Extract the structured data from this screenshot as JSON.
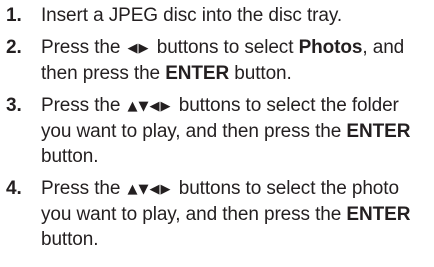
{
  "steps": [
    {
      "num": "1.",
      "p1": "Insert a JPEG disc into the disc tray."
    },
    {
      "num": "2.",
      "p1": "Press the ",
      "arrows": "◀▶",
      "p2": " buttons to select ",
      "bold1": "Photos",
      "p3": ", and then press the ",
      "bold2": "ENTER",
      "p4": " button."
    },
    {
      "num": "3.",
      "p1": "Press the ",
      "arrows": "▲▼◀▶",
      "p2": " buttons to select the folder you want to play, and then press the ",
      "bold1": "ENTER",
      "p3": " button."
    },
    {
      "num": "4.",
      "p1": "Press the ",
      "arrows": "▲▼◀▶",
      "p2": " buttons to select the photo you want to play, and then press the ",
      "bold1": "ENTER",
      "p3": " button."
    }
  ]
}
